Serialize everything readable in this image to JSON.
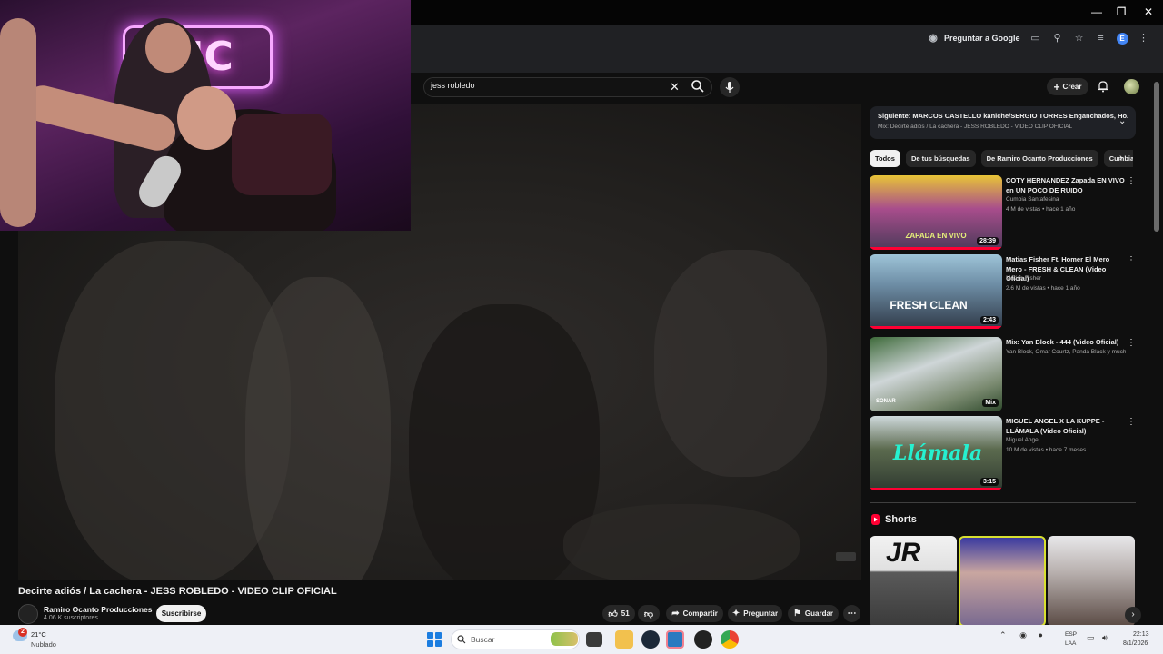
{
  "browser": {
    "ask_google": "Preguntar a Google",
    "profile_letter": "E",
    "window_controls": [
      "minimize-icon",
      "restore-icon",
      "close-icon"
    ]
  },
  "youtube": {
    "search": {
      "query": "jess robledo"
    },
    "create_label": "Crear",
    "video": {
      "title": "Decirte adiós / La cachera - JESS ROBLEDO - VIDEO CLIP OFICIAL",
      "channel": "Ramiro Ocanto Producciones",
      "subscribers": "4.06 K suscriptores",
      "subscribe_label": "Suscribirse",
      "likes": "51",
      "share_label": "Compartir",
      "ask_label": "Preguntar",
      "save_label": "Guardar"
    },
    "up_next": {
      "title": "Siguiente: MARCOS CASTELLO kaniche/SERGIO TORRES Enganchados, Ho...",
      "subtitle": "Mix: Decirte adiós / La cachera - JESS ROBLEDO - VIDEO CLIP OFICIAL"
    },
    "chips": [
      "Todos",
      "De tus búsquedas",
      "De Ramiro Ocanto Producciones",
      "Cumbia"
    ],
    "recommendations": [
      {
        "title": "COTY HERNANDEZ Zapada EN VIVO en UN POCO DE RUIDO",
        "channel": "Cumbia Santafesina",
        "meta": "4 M de vistas • hace 1 año",
        "duration": "28:39",
        "thumb_text": "ZAPADA EN VIVO"
      },
      {
        "title": "Matias Fisher Ft. Homer El Mero Mero - FRESH & CLEAN (Video Oficial)",
        "channel": "Matias Fisher",
        "meta": "2.6 M de vistas • hace 1 año",
        "duration": "2:43",
        "thumb_text": "FRESH CLEAN"
      },
      {
        "title": "Mix: Yan Block - 444 (Video Oficial)",
        "channel": "Yan Block, Omar Courtz, Panda Black y muchos ...",
        "meta": "",
        "duration": "Mix",
        "thumb_text": "SONAR"
      },
      {
        "title": "MIGUEL ANGEL X LA KUPPE - LLÁMALA (Video Oficial)",
        "channel": "Miguel Angel",
        "meta": "10 M de vistas • hace 7 meses",
        "duration": "3:15",
        "thumb_text": "Llámala"
      }
    ],
    "shorts_label": "Shorts",
    "shorts": [
      {
        "thumb_text": "JR"
      },
      {
        "thumb_text": ""
      },
      {
        "thumb_text": ""
      }
    ]
  },
  "webcam": {
    "neon_text": "TIC"
  },
  "taskbar": {
    "weather_badge": "2",
    "temperature": "21°C",
    "weather": "Nublado",
    "search_placeholder": "Buscar",
    "lang_top": "ESP",
    "lang_bottom": "LAA",
    "time": "22:13",
    "date": "8/1/2026"
  },
  "colors": {
    "accent_red": "#ff0033",
    "yt_background": "#0f0f0f",
    "chip_bg": "#272727",
    "taskbar_bg": "#eef0f6"
  }
}
